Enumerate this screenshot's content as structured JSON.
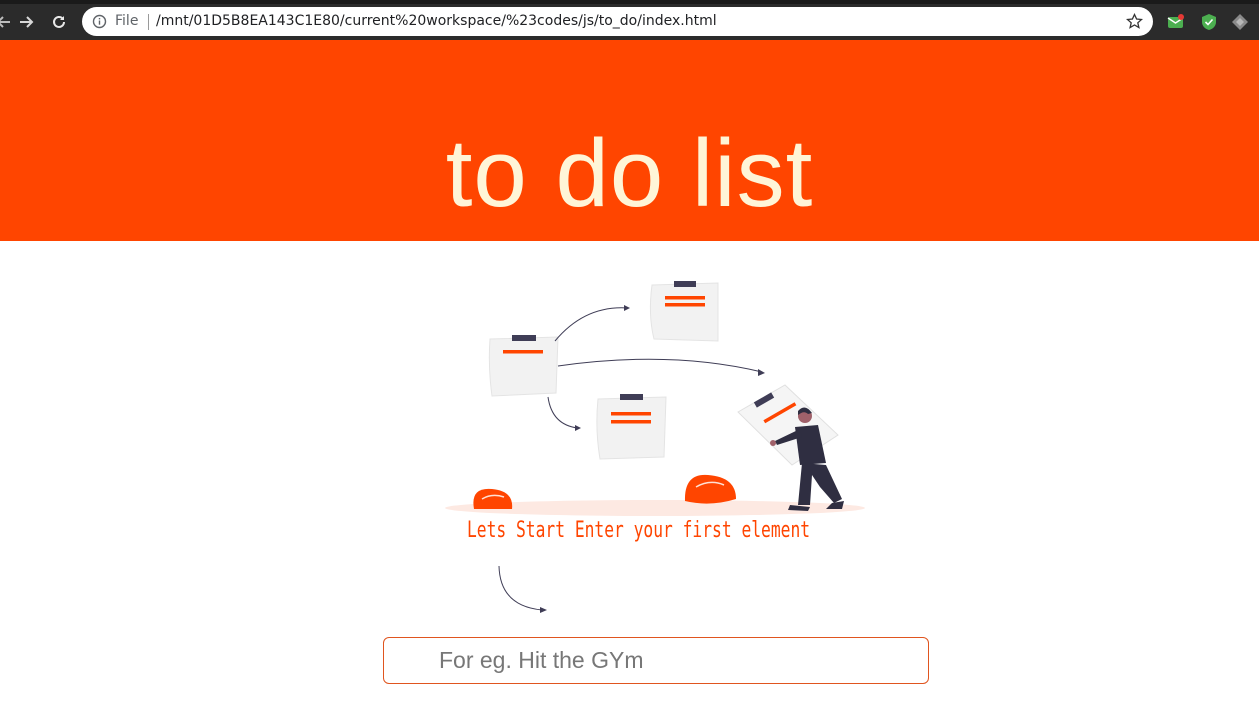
{
  "browser": {
    "file_label": "File",
    "url": "/mnt/01D5B8EA143C1E80/current%20workspace/%23codes/js/to_do/index.html",
    "icons": [
      "back-icon",
      "forward-icon",
      "reload-icon",
      "info-icon",
      "star-icon",
      "extension-icon"
    ]
  },
  "header": {
    "title": "to do list",
    "background": "#ff4500",
    "title_color": "#fff5d7"
  },
  "main": {
    "tagline": "Lets Start Enter your first element",
    "input": {
      "placeholder": "For eg. Hit the GYm",
      "value": ""
    }
  }
}
